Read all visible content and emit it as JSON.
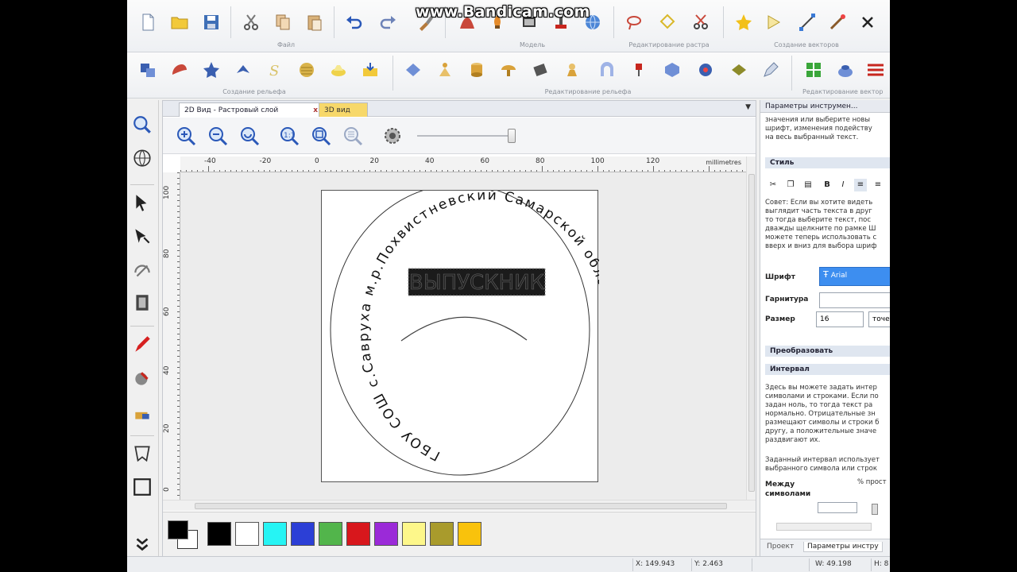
{
  "watermark": "www.Bandicam.com",
  "ribbon": {
    "groups_top": [
      "Файл",
      "Модель",
      "Редактирование растра",
      "Создание векторов"
    ],
    "groups_bottom": [
      "Создание рельефа",
      "Редактирование рельефа",
      "Редактирование вектор"
    ]
  },
  "tabs": {
    "tab_2d": "2D Вид - Растровый слой",
    "tab_3d": "3D вид",
    "close": "x",
    "menu": "▼"
  },
  "ruler": {
    "units": "millimetres",
    "h_ticks": [
      "-40",
      "-20",
      "0",
      "20",
      "40",
      "60",
      "80",
      "100",
      "120"
    ],
    "v_ticks": [
      "100",
      "80",
      "60",
      "40",
      "20",
      "0"
    ]
  },
  "design": {
    "arc_text": "ГБОУ СОШ с.Саврухa м.р.Похвистневский Самарской области",
    "selected_text": "ВЫПУСКНИК"
  },
  "palette": {
    "fg_color": "#000000",
    "bg_color": "#ffffff",
    "colors": [
      "#000000",
      "#ffffff",
      "#26f4f4",
      "#2c3fd6",
      "#52b54b",
      "#d8171c",
      "#9b2ad8",
      "#fdf78a",
      "#a99b2c",
      "#f9c20c"
    ]
  },
  "panel": {
    "title": "Параметры инструмен...",
    "intro": [
      "значения или выберите новы",
      "шрифт, изменения подейству",
      "на весь выбранный текст."
    ],
    "style_section": "Стиль",
    "tip_lines": [
      "Совет: Если вы хотите видеть",
      "выглядит часть текста в друг",
      "то тогда выберите текст, пос",
      "дважды щелкните по рамке Ш",
      "можете теперь использовать с",
      "вверх и вниз для выбора шриф"
    ],
    "font_label": "Шрифт",
    "font_value": "Arial",
    "typeface_label": "Гарнитура",
    "size_label": "Размер",
    "size_value": "16",
    "size_unit": "точе",
    "transform_section": "Преобразовать",
    "interval_section": "Интервал",
    "interval_text": [
      "Здесь вы можете задать интер",
      "символами и строками. Если по",
      "задан ноль, то тогда текст ра",
      "нормально. Отрицательные зн",
      "размещают символы и строки б",
      "другу, а положительные значе",
      "раздвигают их."
    ],
    "interval_text2": [
      "Заданный интервал использует",
      "выбранного символа или строк"
    ],
    "between_label": "Между символами",
    "between_unit": "% прост",
    "tab_project": "Проект",
    "tab_params": "Параметры инстру"
  },
  "status": {
    "x": "X: 149.943",
    "y": "Y: 2.463",
    "w": "W: 49.198",
    "h": "H: 8"
  }
}
